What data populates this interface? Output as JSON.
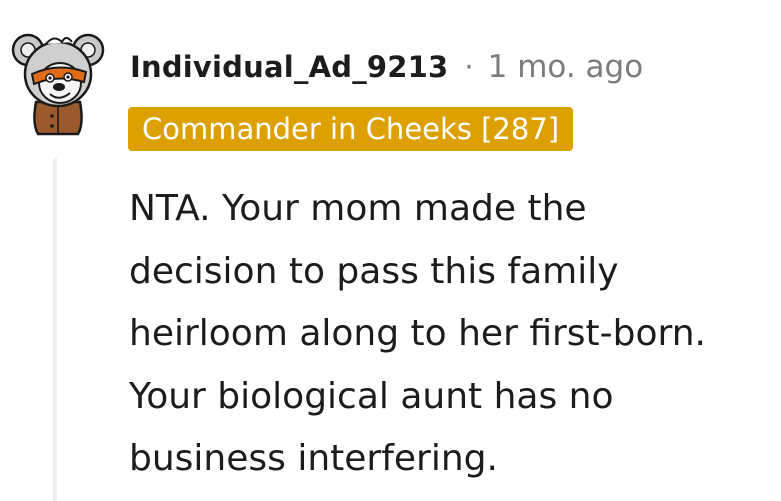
{
  "comment": {
    "author": "Individual_Ad_9213",
    "separator": "·",
    "timestamp": "1 mo. ago",
    "flair": "Commander in Cheeks [287]",
    "body_lines": [
      "NTA. Your mom made the",
      "decision to pass this family",
      "heirloom along to her first-born.",
      "Your biological aunt has no",
      "business interfering."
    ]
  },
  "colors": {
    "flair_background": "#dca100",
    "flair_text": "#ffffff",
    "username": "#1c1c1c",
    "timestamp": "#7c7c7c",
    "body_text": "#1c1c1c",
    "thread_line": "#edeff1"
  },
  "icons": {
    "avatar": "koala-avatar-icon"
  }
}
